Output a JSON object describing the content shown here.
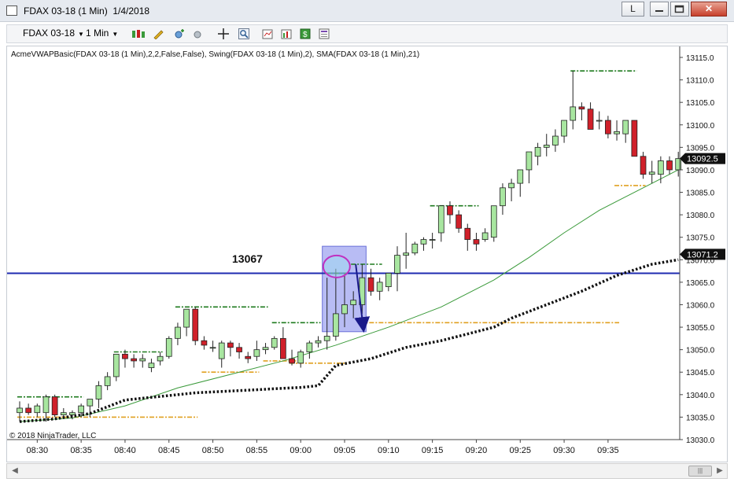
{
  "window": {
    "title": "FDAX 03-18 (1 Min)  1/4/2018",
    "link_button_label": "L",
    "close_icon": "close-icon"
  },
  "toolbar": {
    "instrument": "FDAX 03-18",
    "interval": "1 Min"
  },
  "chart": {
    "indicator_label": "AcmeVWAPBasic(FDAX 03-18 (1 Min),2,2,False,False), Swing(FDAX 03-18 (1 Min),2), SMA(FDAX 03-18 (1 Min),21)",
    "copyright": "© 2018 NinjaTrader, LLC",
    "level_annotation": "13067",
    "last_price_label": "13092.5",
    "line_price_label": "13071.2",
    "colors": {
      "up_candle": "#a8e6a0",
      "down_candle": "#d0202a",
      "horizontal_line": "#1f2bb0",
      "sma": "#3a9a3a",
      "vwap": "#111111",
      "swing_high": "#1e7a1e",
      "swing_low": "#e0a020",
      "highlight_box": "#9a9ff0",
      "ellipse": "#c030c0",
      "arrow": "#1a1a8a"
    }
  },
  "chart_data": {
    "type": "candlestick",
    "y_axis": {
      "min": 13030,
      "max": 13115,
      "ticks": [
        "13030.0",
        "13035.0",
        "13040.0",
        "13045.0",
        "13050.0",
        "13055.0",
        "13060.0",
        "13065.0",
        "13070.0",
        "13075.0",
        "13080.0",
        "13085.0",
        "13090.0",
        "13095.0",
        "13100.0",
        "13105.0",
        "13110.0",
        "13115.0"
      ]
    },
    "x_axis": {
      "tick_labels": [
        "08:30",
        "08:35",
        "08:40",
        "08:45",
        "08:50",
        "08:55",
        "09:00",
        "09:05",
        "09:10",
        "09:15",
        "09:20",
        "09:25",
        "09:30",
        "09:35"
      ]
    },
    "start_minute": "08:28",
    "candles": [
      [
        13036,
        13038.5,
        13034,
        13037
      ],
      [
        13037,
        13038,
        13035.5,
        13036
      ],
      [
        13036,
        13038,
        13035,
        13037.5
      ],
      [
        13036,
        13040,
        13034,
        13039.5
      ],
      [
        13039.5,
        13040,
        13035,
        13035.5
      ],
      [
        13035.5,
        13037,
        13035,
        13036
      ],
      [
        13035.5,
        13036.5,
        13034.5,
        13036
      ],
      [
        13036,
        13038,
        13035,
        13037.5
      ],
      [
        13037.5,
        13039,
        13035,
        13039
      ],
      [
        13039,
        13043,
        13037,
        13042
      ],
      [
        13042,
        13045,
        13041,
        13044
      ],
      [
        13044,
        13049,
        13043,
        13049
      ],
      [
        13049,
        13050,
        13046,
        13048
      ],
      [
        13048,
        13049,
        13046,
        13047.5
      ],
      [
        13047.5,
        13049,
        13046,
        13048
      ],
      [
        13046,
        13048,
        13045,
        13047
      ],
      [
        13047.5,
        13049.5,
        13046.5,
        13048.5
      ],
      [
        13048.5,
        13053,
        13048,
        13052.5
      ],
      [
        13052.5,
        13056,
        13051,
        13055
      ],
      [
        13055,
        13059,
        13053,
        13059
      ],
      [
        13059,
        13059.5,
        13051,
        13052
      ],
      [
        13052,
        13053,
        13050,
        13051
      ],
      [
        13050.5,
        13052,
        13049.5,
        13050.5
      ],
      [
        13048,
        13052,
        13046,
        13051.5
      ],
      [
        13051.5,
        13052,
        13048.5,
        13050.5
      ],
      [
        13050.5,
        13051.5,
        13048,
        13049.5
      ],
      [
        13048.5,
        13049.5,
        13047,
        13048
      ],
      [
        13048.5,
        13052,
        13047.5,
        13050
      ],
      [
        13050,
        13051.5,
        13049,
        13050.5
      ],
      [
        13050.5,
        13053,
        13050,
        13052.5
      ],
      [
        13052.5,
        13055,
        13048,
        13048
      ],
      [
        13048,
        13050,
        13046.5,
        13047
      ],
      [
        13047,
        13050,
        13046,
        13049.5
      ],
      [
        13049.5,
        13052,
        13048,
        13051.5
      ],
      [
        13051.5,
        13053,
        13050.5,
        13052
      ],
      [
        13052,
        13066,
        13050,
        13053
      ],
      [
        13053,
        13068,
        13052,
        13058
      ],
      [
        13058,
        13067,
        13055,
        13060
      ],
      [
        13060,
        13063,
        13057,
        13061
      ],
      [
        13060,
        13069,
        13058,
        13066
      ],
      [
        13066,
        13068,
        13062,
        13063
      ],
      [
        13063,
        13066,
        13061,
        13065
      ],
      [
        13064,
        13066,
        13063,
        13067
      ],
      [
        13067,
        13073,
        13063,
        13071
      ],
      [
        13071,
        13076,
        13068,
        13071.5
      ],
      [
        13071.5,
        13074,
        13071,
        13073.5
      ],
      [
        13073.5,
        13075,
        13072,
        13074.5
      ],
      [
        13074.5,
        13076,
        13072.5,
        13074.5
      ],
      [
        13076,
        13082,
        13074,
        13082
      ],
      [
        13082,
        13083,
        13078,
        13080
      ],
      [
        13080,
        13081,
        13076,
        13077
      ],
      [
        13077,
        13078,
        13072,
        13074.5
      ],
      [
        13074.5,
        13076,
        13072,
        13073.5
      ],
      [
        13074.5,
        13077,
        13074,
        13076
      ],
      [
        13075,
        13082,
        13074,
        13082
      ],
      [
        13082,
        13087,
        13080,
        13086
      ],
      [
        13086,
        13088,
        13083,
        13087
      ],
      [
        13087,
        13089,
        13084,
        13090
      ],
      [
        13090,
        13093,
        13087,
        13094
      ],
      [
        13093,
        13096,
        13091,
        13095
      ],
      [
        13095,
        13098,
        13093,
        13095.5
      ],
      [
        13095.5,
        13099,
        13094,
        13097.5
      ],
      [
        13097.5,
        13101,
        13096,
        13101
      ],
      [
        13101,
        13112,
        13099,
        13104
      ],
      [
        13104,
        13105,
        13101,
        13103.5
      ],
      [
        13103.5,
        13105,
        13099,
        13099
      ],
      [
        13101,
        13103,
        13099,
        13101
      ],
      [
        13101,
        13102,
        13097,
        13098
      ],
      [
        13098,
        13101,
        13096.5,
        13098.5
      ],
      [
        13098,
        13101,
        13096,
        13101
      ],
      [
        13101,
        13101,
        13093,
        13093
      ],
      [
        13093,
        13094,
        13088,
        13089
      ],
      [
        13089,
        13092,
        13087,
        13089.5
      ],
      [
        13089,
        13093,
        13087,
        13092
      ],
      [
        13092,
        13093,
        13089,
        13090
      ],
      [
        13090,
        13094,
        13088.5,
        13092.5
      ]
    ],
    "sma_21": [
      [
        0,
        13034
      ],
      [
        6,
        13034.8
      ],
      [
        12,
        13037.5
      ],
      [
        18,
        13041.5
      ],
      [
        24,
        13044.5
      ],
      [
        30,
        13047.5
      ],
      [
        36,
        13051
      ],
      [
        42,
        13055
      ],
      [
        48,
        13059.5
      ],
      [
        54,
        13065.5
      ],
      [
        58,
        13070.5
      ],
      [
        62,
        13076
      ],
      [
        66,
        13081
      ],
      [
        70,
        13085
      ],
      [
        74,
        13089
      ],
      [
        75,
        13090
      ]
    ],
    "vwap": [
      [
        0,
        13034
      ],
      [
        4,
        13034.6
      ],
      [
        8,
        13035.8
      ],
      [
        12,
        13038.8
      ],
      [
        16,
        13039.6
      ],
      [
        20,
        13040.4
      ],
      [
        24,
        13040.8
      ],
      [
        28,
        13041.2
      ],
      [
        32,
        13041.6
      ],
      [
        34,
        13042
      ],
      [
        36,
        13046.5
      ],
      [
        40,
        13048
      ],
      [
        44,
        13050.5
      ],
      [
        48,
        13052
      ],
      [
        52,
        13054
      ],
      [
        54,
        13055
      ],
      [
        56,
        13057
      ],
      [
        60,
        13060
      ],
      [
        64,
        13063
      ],
      [
        68,
        13066.5
      ],
      [
        72,
        13069
      ],
      [
        75,
        13070
      ]
    ],
    "horizontal_line": 13067,
    "swing_highs": [
      {
        "start": 0,
        "end": 7,
        "price": 13039.5
      },
      {
        "start": 11,
        "end": 16,
        "price": 13049.5
      },
      {
        "start": 18,
        "end": 28,
        "price": 13059.5
      },
      {
        "start": 29,
        "end": 34,
        "price": 13056
      },
      {
        "start": 35,
        "end": 37,
        "price": 13067
      },
      {
        "start": 38,
        "end": 41,
        "price": 13069
      },
      {
        "start": 47,
        "end": 52,
        "price": 13082
      },
      {
        "start": 63,
        "end": 70,
        "price": 13112
      }
    ],
    "swing_lows": [
      {
        "start": 0,
        "end": 20,
        "price": 13035
      },
      {
        "start": 21,
        "end": 27,
        "price": 13045
      },
      {
        "start": 28,
        "end": 32,
        "price": 13047.5
      },
      {
        "start": 31,
        "end": 37,
        "price": 13047
      },
      {
        "start": 39,
        "end": 68,
        "price": 13056
      },
      {
        "start": 68,
        "end": 71,
        "price": 13086.5
      }
    ]
  }
}
